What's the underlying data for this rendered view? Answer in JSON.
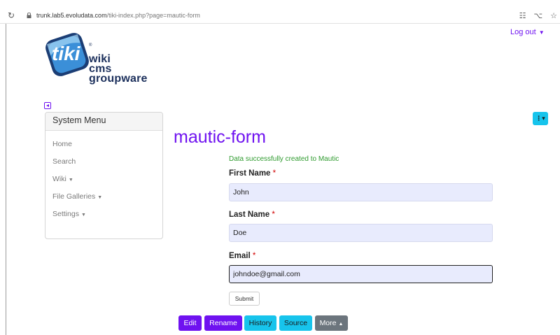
{
  "browser": {
    "url_host": "trunk.lab5.evoludata.com",
    "url_path": "/tiki-index.php?page=mautic-form"
  },
  "header": {
    "logout_label": "Log out",
    "logo_text_lines": [
      "wiki",
      "cms",
      "groupware"
    ]
  },
  "sidebar": {
    "title": "System Menu",
    "items": [
      {
        "label": "Home",
        "dropdown": false
      },
      {
        "label": "Search",
        "dropdown": false
      },
      {
        "label": "Wiki",
        "dropdown": true
      },
      {
        "label": "File Galleries",
        "dropdown": true
      },
      {
        "label": "Settings",
        "dropdown": true
      }
    ]
  },
  "main": {
    "page_title": "mautic-form",
    "success_message": "Data successfully created to Mautic",
    "form": {
      "first_name_label": "First Name",
      "first_name_value": "John",
      "last_name_label": "Last Name",
      "last_name_value": "Doe",
      "email_label": "Email",
      "email_value": "johndoe@gmail.com",
      "required_mark": "*",
      "submit_label": "Submit"
    }
  },
  "actions": {
    "edit": "Edit",
    "rename": "Rename",
    "history": "History",
    "source": "Source",
    "more": "More"
  },
  "colors": {
    "primary": "#6f12f0",
    "info": "#17c4ec",
    "secondary": "#6c757d",
    "success": "#2f9b2f"
  }
}
